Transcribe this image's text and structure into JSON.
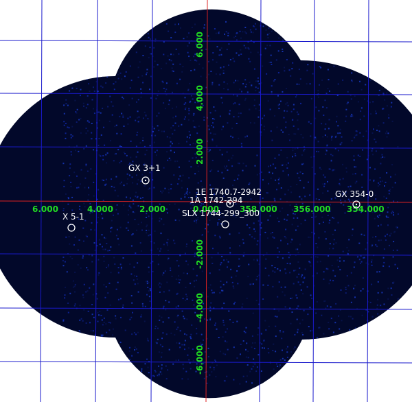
{
  "colors": {
    "background": "#ffffff",
    "sky": "#02082a",
    "grid": "#1a1acc",
    "axis": "#dd2222",
    "tick_text": "#22dd22",
    "source": "#ffffff"
  },
  "axes": {
    "x_ticks": [
      "6.000",
      "4.000",
      "2.000",
      "0.000",
      "358.000",
      "356.000",
      "354.000"
    ],
    "y_ticks": [
      "6.000",
      "4.000",
      "2.000",
      "-2.000",
      "-4.000",
      "-6.000"
    ]
  },
  "sources": [
    {
      "name": "GX 3+1",
      "marker": "circle-dot"
    },
    {
      "name": "1E 1740.7-2942",
      "marker": "circle-dot"
    },
    {
      "name": "1A 1742-294",
      "marker": "circle"
    },
    {
      "name": "SLX 1744-299_300",
      "marker": "circle"
    },
    {
      "name": "GX 354-0",
      "marker": "circle-dot"
    },
    {
      "name": "X 5-1",
      "marker": "circle"
    }
  ]
}
